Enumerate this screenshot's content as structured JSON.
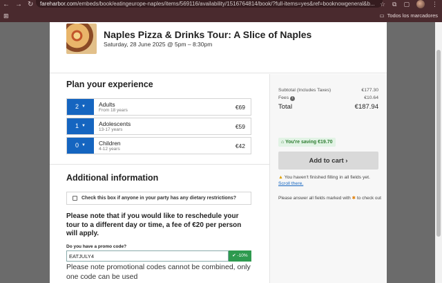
{
  "browser": {
    "url_host": "fareharbor.com",
    "url_path": "/embeds/book/eatingeurope-naples/items/569116/availability/1516764814/book/?full-items=yes&ref=booknowgeneral&b...",
    "bookmarks_folder": "Todos los marcadores"
  },
  "tour": {
    "title": "Naples Pizza & Drinks Tour: A Slice of Naples",
    "datetime": "Saturday, 28 June 2025 @ 5pm – 8:30pm"
  },
  "plan": {
    "heading": "Plan your experience",
    "rows": [
      {
        "qty": "2",
        "name": "Adults",
        "sub": "From 18 years",
        "price": "€69"
      },
      {
        "qty": "1",
        "name": "Adolescents",
        "sub": "13-17 years",
        "price": "€59"
      },
      {
        "qty": "0",
        "name": "Children",
        "sub": "4-12 years",
        "price": "€42"
      }
    ]
  },
  "additional": {
    "heading": "Additional information",
    "dietary_label": "Check this box if anyone in your party has any dietary restrictions?",
    "reschedule_notice": "Please note that if you would like to reschedule your tour to a different day or time, a fee of €20 per person will apply.",
    "promo_label": "Do you have a promo code?",
    "promo_value": "EATJULY4",
    "promo_badge": "-10%",
    "promo_note": "Please note promotional codes cannot be combined, only one code can be used"
  },
  "summary": {
    "subtotal_label": "Subtotal (Includes Taxes)",
    "subtotal_value": "€177.30",
    "fees_label": "Fees",
    "fees_value": "€10.64",
    "total_label": "Total",
    "total_value": "€187.94",
    "saving": "You're saving €19.70",
    "cart_button": "Add to cart ›",
    "warning": "You haven't finished filling in all fields yet.",
    "scroll_link": "Scroll there.",
    "field_note_pre": "Please answer all fields marked with",
    "field_note_post": "to check out"
  },
  "colors": {
    "primary": "#1565c0",
    "success": "#2e9a4f",
    "chrome": "#4a2a2e"
  }
}
